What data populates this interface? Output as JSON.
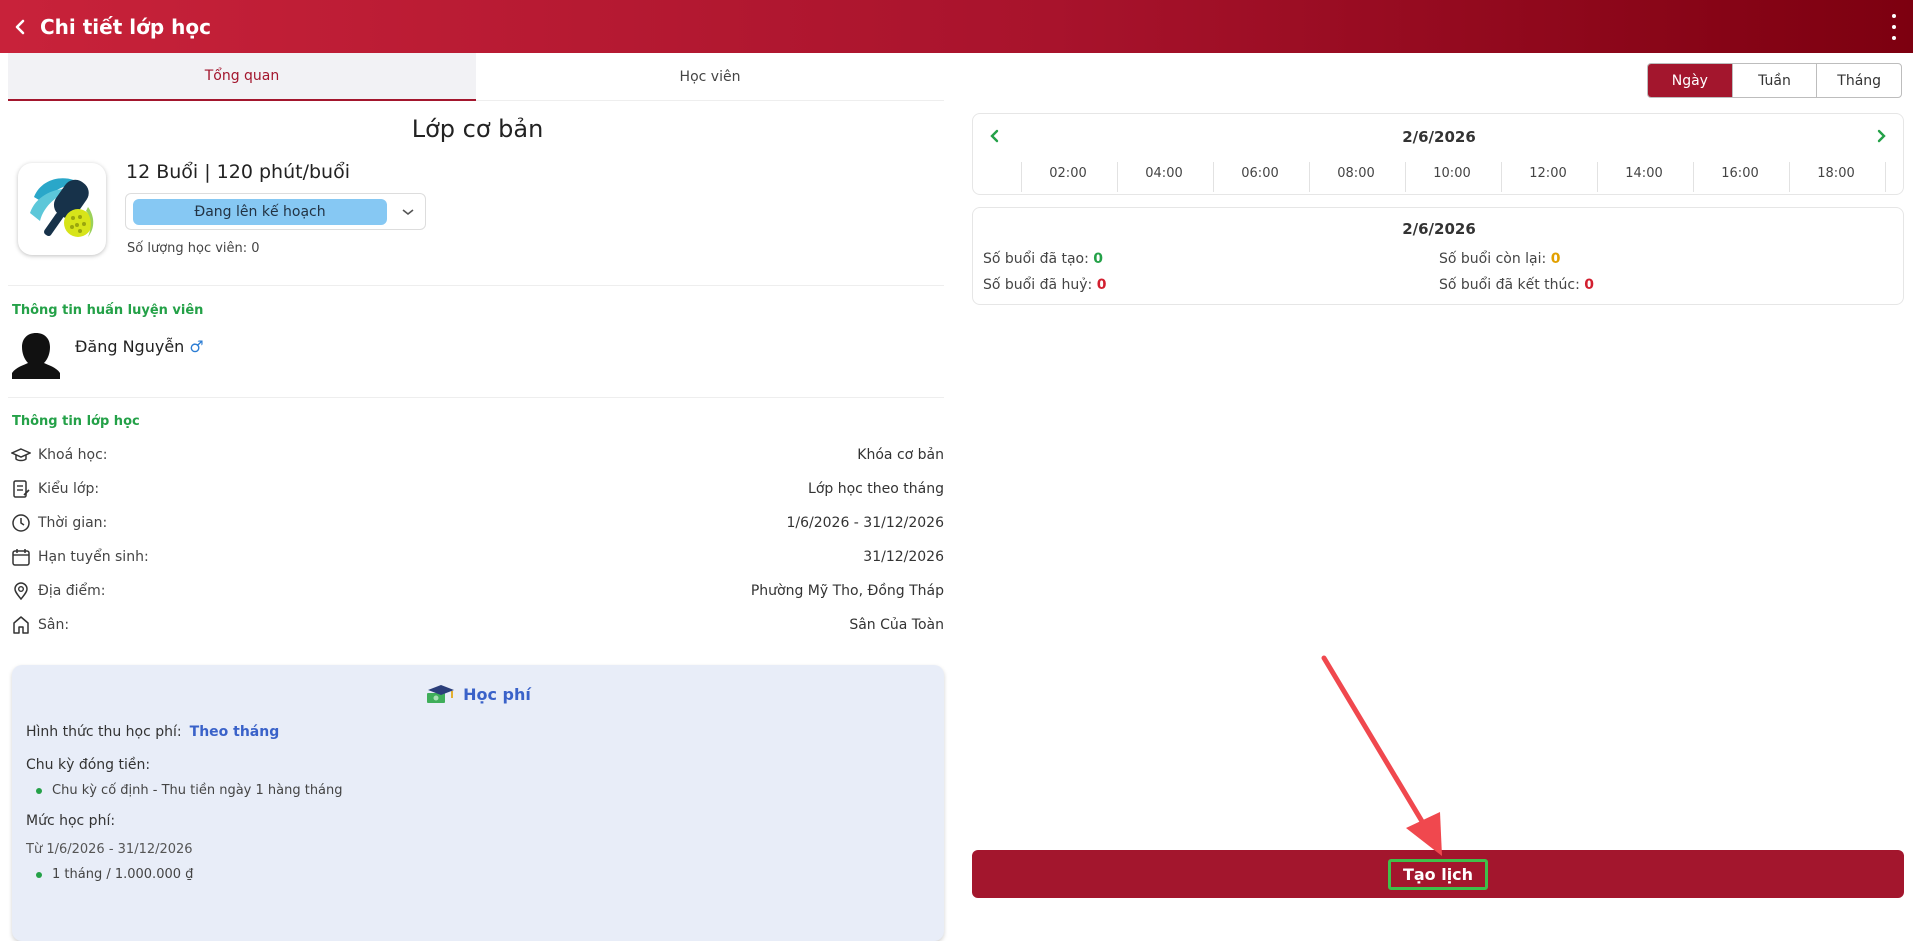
{
  "header": {
    "title": "Chi tiết lớp học"
  },
  "tabs": [
    {
      "label": "Tổng quan",
      "active": true
    },
    {
      "label": "Học viên",
      "active": false
    }
  ],
  "class": {
    "name": "Lớp cơ bản",
    "sessions": "12 Buổi | 120 phút/buổi",
    "status": "Đang lên kế hoạch",
    "student_count": "Số lượng học viên: 0"
  },
  "coach": {
    "section_title": "Thông tin huấn luyện viên",
    "name": "Đăng Nguyễn",
    "gender_symbol": "♂"
  },
  "class_info": {
    "section_title": "Thông tin lớp học",
    "rows": [
      {
        "icon": "graduation-cap-icon",
        "label": "Khoá học:",
        "value": "Khóa cơ bản"
      },
      {
        "icon": "class-type-icon",
        "label": "Kiểu lớp:",
        "value": "Lớp học theo tháng"
      },
      {
        "icon": "clock-icon",
        "label": "Thời gian:",
        "value": "1/6/2026 - 31/12/2026"
      },
      {
        "icon": "calendar-icon",
        "label": "Hạn tuyển sinh:",
        "value": "31/12/2026"
      },
      {
        "icon": "location-pin-icon",
        "label": "Địa điểm:",
        "value": "Phường Mỹ Tho, Đồng Tháp"
      },
      {
        "icon": "house-icon",
        "label": "Sân:",
        "value": "Sân Của Toàn"
      }
    ]
  },
  "fee": {
    "title": "Học phí",
    "method_label": "Hình thức thu học phí:",
    "method_value": "Theo tháng",
    "cycle_label": "Chu kỳ đóng tiền:",
    "cycle_item": "Chu kỳ cố định - Thu tiền ngày 1 hàng tháng",
    "level_label": "Mức học phí:",
    "period": "Từ 1/6/2026 - 31/12/2026",
    "price_item": "1 tháng / 1.000.000 ₫"
  },
  "view_toggle": [
    {
      "label": "Ngày",
      "active": true
    },
    {
      "label": "Tuần",
      "active": false
    },
    {
      "label": "Tháng",
      "active": false
    }
  ],
  "timeline": {
    "date": "2/6/2026",
    "hours": [
      "02:00",
      "04:00",
      "06:00",
      "08:00",
      "10:00",
      "12:00",
      "14:00",
      "16:00",
      "18:00"
    ]
  },
  "stats": {
    "date": "2/6/2026",
    "created_label": "Số buổi đã tạo:",
    "created_value": "0",
    "remaining_label": "Số buổi còn lại:",
    "remaining_value": "0",
    "cancelled_label": "Số buổi đã huỷ:",
    "cancelled_value": "0",
    "finished_label": "Số buổi đã kết thúc:",
    "finished_value": "0"
  },
  "actions": {
    "create_schedule": "Tạo lịch"
  },
  "colors": {
    "primary": "#a3162d",
    "header_start": "#c8223a",
    "header_end": "#7d0010",
    "green": "#24a148",
    "fee_accent": "#3a62c9",
    "status_pill": "#86c8f3",
    "annotation_arrow": "#f0484e",
    "annotation_box": "#3fbf4a"
  }
}
